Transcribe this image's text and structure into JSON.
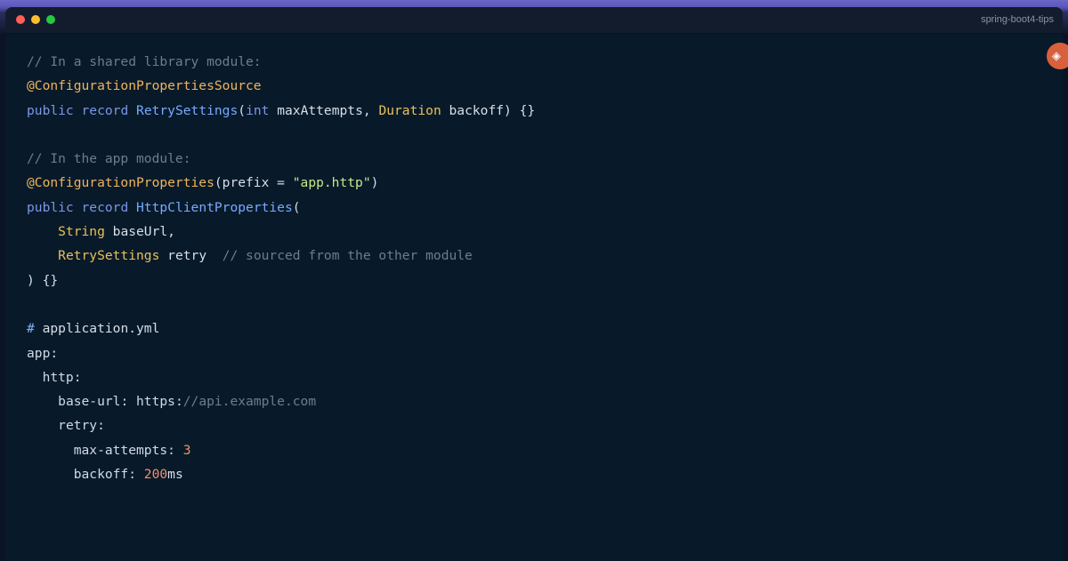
{
  "window": {
    "title": "spring-boot4-tips"
  },
  "colors": {
    "background": "#081a29",
    "titlebar": "#121c2c",
    "comment": "#6f7b8f",
    "annotation": "#f0b35e",
    "keyword": "#7b96e6",
    "type": "#e8c15b",
    "string": "#c7e889",
    "number": "#f38f6b",
    "fab": "#d9603d"
  },
  "icons": {
    "fab": "diamond-icon"
  },
  "code": {
    "l1": "// In a shared library module:",
    "l2_annotation": "@ConfigurationPropertiesSource",
    "l3_public": "public",
    "l3_record": "record",
    "l3_class": "RetrySettings",
    "l3_open": "(",
    "l3_int": "int",
    "l3_rest1": " maxAttempts, ",
    "l3_duration": "Duration",
    "l3_rest2": " backoff) {}",
    "l5": "// In the app module:",
    "l6_annotation": "@ConfigurationProperties",
    "l6_open": "(prefix = ",
    "l6_string": "\"app.http\"",
    "l6_close": ")",
    "l7_public": "public",
    "l7_record": "record",
    "l7_class": "HttpClientProperties",
    "l7_open": "(",
    "l8_type": "String",
    "l8_rest": " baseUrl,",
    "l9_type": "RetrySettings",
    "l9_rest": " retry  ",
    "l9_comment": "// sourced from the other module",
    "l10": ") {}",
    "l12_hash": "#",
    "l12_rest": " application.yml",
    "l13": "app:",
    "l14": "http:",
    "l15_key": "base-url: https:",
    "l15_comment": "//api.example.com",
    "l16": "retry:",
    "l17_key": "max-attempts: ",
    "l17_num": "3",
    "l18_key": "backoff: ",
    "l18_num": "200",
    "l18_unit": "ms"
  }
}
